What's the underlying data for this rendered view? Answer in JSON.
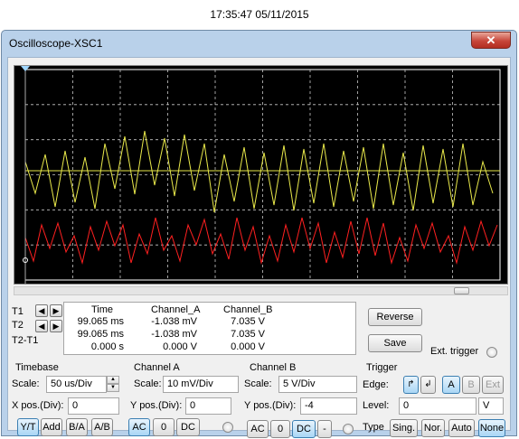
{
  "timestamp": "17:35:47 05/11/2015",
  "window": {
    "title": "Oscilloscope-XSC1",
    "close_glyph": "✕"
  },
  "colors": {
    "channel_a": "#e8e84a",
    "channel_b": "#ff2020",
    "grid": "#c8c8c8",
    "screen": "#000000"
  },
  "readout": {
    "row_labels": [
      "T1",
      "T2",
      "T2-T1"
    ],
    "headers": [
      "Time",
      "Channel_A",
      "Channel_B"
    ],
    "rows": [
      [
        "99.065 ms",
        "-1.038 mV",
        "7.035 V"
      ],
      [
        "99.065 ms",
        "-1.038 mV",
        "7.035 V"
      ],
      [
        "0.000 s",
        "0.000 V",
        "0.000 V"
      ]
    ]
  },
  "buttons": {
    "reverse": "Reverse",
    "save": "Save"
  },
  "ext_trigger_label": "Ext. trigger",
  "timebase": {
    "title": "Timebase",
    "scale_label": "Scale:",
    "scale_value": "50 us/Div",
    "xpos_label": "X pos.(Div):",
    "xpos_value": "0",
    "modes": [
      "Y/T",
      "Add",
      "B/A",
      "A/B"
    ]
  },
  "channel_a": {
    "title": "Channel A",
    "scale_label": "Scale:",
    "scale_value": "10 mV/Div",
    "ypos_label": "Y pos.(Div):",
    "ypos_value": "0",
    "coupling": [
      "AC",
      "0",
      "DC"
    ]
  },
  "channel_b": {
    "title": "Channel B",
    "scale_label": "Scale:",
    "scale_value": "5 V/Div",
    "ypos_label": "Y pos.(Div):",
    "ypos_value": "-4",
    "coupling": [
      "AC",
      "0",
      "DC",
      "-"
    ]
  },
  "trigger": {
    "title": "Trigger",
    "edge_label": "Edge:",
    "edge_rising": "↱",
    "edge_falling": "↲",
    "sources": [
      "A",
      "B",
      "Ext"
    ],
    "level_label": "Level:",
    "level_value": "0",
    "level_unit": "V",
    "type_label": "Type",
    "types": [
      "Sing.",
      "Nor.",
      "Auto",
      "None"
    ]
  }
}
